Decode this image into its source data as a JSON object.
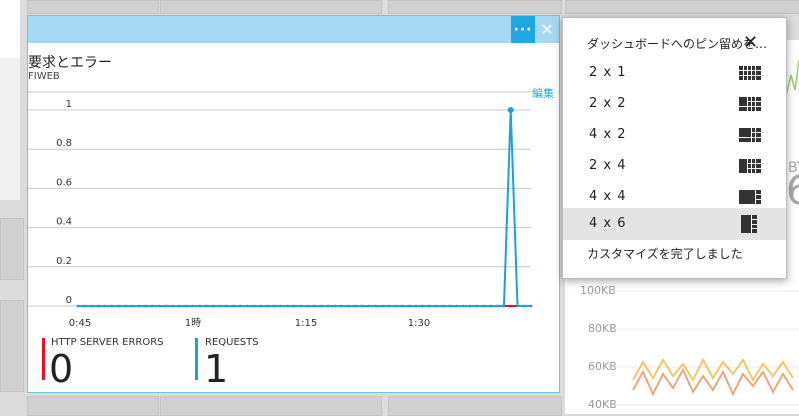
{
  "tile": {
    "title": "要求とエラー",
    "subtitle": "FIWEB",
    "edit_label": "編集",
    "more_label": "···",
    "close_label": "✕"
  },
  "chart_data": {
    "type": "line",
    "x_tick_labels": [
      "0:45",
      "1時",
      "1:15",
      "1:30"
    ],
    "ylim": [
      0,
      1
    ],
    "y_ticks": [
      0,
      0.2,
      0.4,
      0.6,
      0.8,
      1
    ],
    "y_tick_labels": [
      "0",
      "0.2",
      "0.4",
      "0.6",
      "0.8",
      "1"
    ],
    "grid": true,
    "series": [
      {
        "name": "REQUESTS",
        "color": "#1ba1e2",
        "values": [
          0,
          0,
          0,
          0,
          0,
          0,
          0,
          0,
          0,
          0,
          0,
          0,
          0,
          0,
          0,
          0,
          0,
          0,
          0,
          0,
          0,
          0,
          0,
          0,
          0,
          0,
          0,
          0,
          0,
          0,
          0,
          0,
          0,
          0,
          0,
          0,
          0,
          0,
          0,
          0,
          0,
          0,
          0,
          0,
          0,
          0,
          0,
          0,
          0,
          0,
          0,
          0,
          0,
          0,
          0,
          0,
          0,
          0,
          0,
          0,
          0,
          0,
          0,
          0,
          1,
          0,
          0,
          0
        ]
      },
      {
        "name": "HTTP SERVER ERRORS",
        "color": "#e81123",
        "values": [
          0,
          0,
          0,
          0,
          0,
          0,
          0,
          0,
          0,
          0,
          0,
          0,
          0,
          0,
          0,
          0,
          0,
          0,
          0,
          0,
          0,
          0,
          0,
          0,
          0,
          0,
          0,
          0,
          0,
          0,
          0,
          0,
          0,
          0,
          0,
          0,
          0,
          0,
          0,
          0,
          0,
          0,
          0,
          0,
          0,
          0,
          0,
          0,
          0,
          0,
          0,
          0,
          0,
          0,
          0,
          0,
          0,
          0,
          0,
          0,
          0,
          0,
          0,
          0,
          0,
          0,
          0,
          0
        ]
      }
    ]
  },
  "legend": [
    {
      "label": "HTTP SERVER ERRORS",
      "value": "0",
      "color": "#e81123"
    },
    {
      "label": "REQUESTS",
      "value": "1",
      "color": "#1ba1e2"
    }
  ],
  "menu": {
    "header": "ダッシュボードへのピン留めを…",
    "close_label": "✕",
    "items": [
      {
        "label": "2 x 1",
        "icon": "tile-size-2x1-icon",
        "selected": false
      },
      {
        "label": "2 x 2",
        "icon": "tile-size-2x2-icon",
        "selected": false
      },
      {
        "label": "4 x 2",
        "icon": "tile-size-4x2-icon",
        "selected": false
      },
      {
        "label": "2 x 4",
        "icon": "tile-size-2x4-icon",
        "selected": false
      },
      {
        "label": "4 x 4",
        "icon": "tile-size-4x4-icon",
        "selected": false
      },
      {
        "label": "4 x 6",
        "icon": "tile-size-4x6-icon",
        "selected": true
      }
    ],
    "finish_label": "カスタマイズを完了しました"
  },
  "background": {
    "axis_labels": [
      "100KB",
      "80KB",
      "60KB",
      "40KB"
    ],
    "partial_text": "BY",
    "partial_digit": "6",
    "line_colors": [
      "#f5c56b",
      "#e8a87c"
    ]
  }
}
